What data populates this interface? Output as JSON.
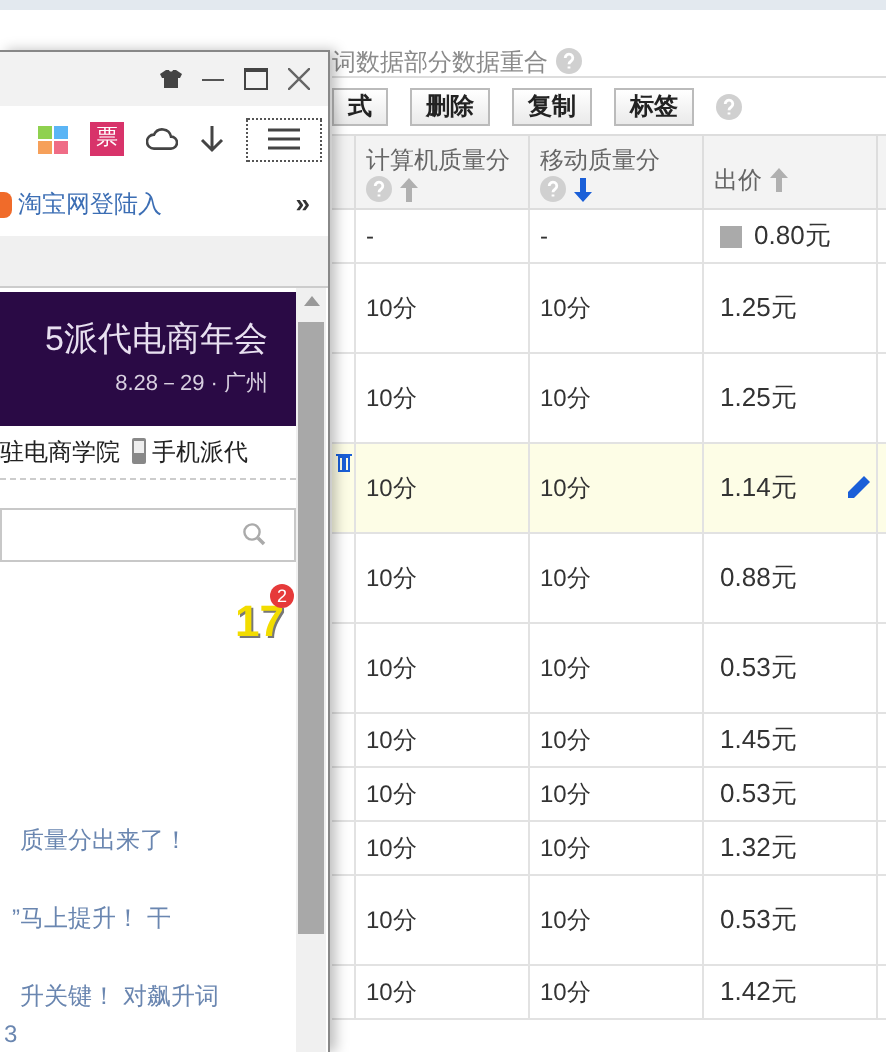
{
  "page": {
    "heading": "词数据部分数据重合",
    "toolbar": [
      "式",
      "删除",
      "复制",
      "标签"
    ],
    "table": {
      "columns": [
        {
          "label": "计算机质量分",
          "help": true,
          "sort_desc": false,
          "active": false
        },
        {
          "label": "移动质量分",
          "help": true,
          "sort_desc": true,
          "active": true
        },
        {
          "label": "出价",
          "help": false,
          "sort_desc": false,
          "active": false
        }
      ],
      "rows": [
        {
          "kind": "short",
          "pc": "-",
          "mobile": "-",
          "bid": "0.80元",
          "bid_icon": true,
          "selected": false
        },
        {
          "kind": "tall",
          "pc": "10分",
          "mobile": "10分",
          "bid": "1.25元",
          "bid_icon": false,
          "selected": false
        },
        {
          "kind": "tall",
          "pc": "10分",
          "mobile": "10分",
          "bid": "1.25元",
          "bid_icon": false,
          "selected": false
        },
        {
          "kind": "tall",
          "pc": "10分",
          "mobile": "10分",
          "bid": "1.14元",
          "bid_icon": false,
          "selected": true
        },
        {
          "kind": "tall",
          "pc": "10分",
          "mobile": "10分",
          "bid": "0.88元",
          "bid_icon": false,
          "selected": false
        },
        {
          "kind": "tall",
          "pc": "10分",
          "mobile": "10分",
          "bid": "0.53元",
          "bid_icon": false,
          "selected": false
        },
        {
          "kind": "short",
          "pc": "10分",
          "mobile": "10分",
          "bid": "1.45元",
          "bid_icon": false,
          "selected": false
        },
        {
          "kind": "short",
          "pc": "10分",
          "mobile": "10分",
          "bid": "0.53元",
          "bid_icon": false,
          "selected": false
        },
        {
          "kind": "short",
          "pc": "10分",
          "mobile": "10分",
          "bid": "1.32元",
          "bid_icon": false,
          "selected": false
        },
        {
          "kind": "tall",
          "pc": "10分",
          "mobile": "10分",
          "bid": "0.53元",
          "bid_icon": false,
          "selected": false
        },
        {
          "kind": "short",
          "pc": "10分",
          "mobile": "10分",
          "bid": "1.42元",
          "bid_icon": false,
          "selected": false
        }
      ]
    }
  },
  "browser": {
    "ticket_label": "票",
    "bookmark": "淘宝网登陆入",
    "more": "»",
    "banner": {
      "title": "5派代电商年会",
      "subtitle": "8.28－29 · 广州"
    },
    "links": [
      {
        "label": "驻电商学院",
        "phone_icon": false
      },
      {
        "label": "手机派代",
        "phone_icon": true
      }
    ],
    "counter": {
      "value": "17",
      "badge": "2"
    },
    "news": [
      "质量分出来了！",
      "”马上提升！ 干",
      "升关键！ 对飙升词",
      "3"
    ]
  }
}
